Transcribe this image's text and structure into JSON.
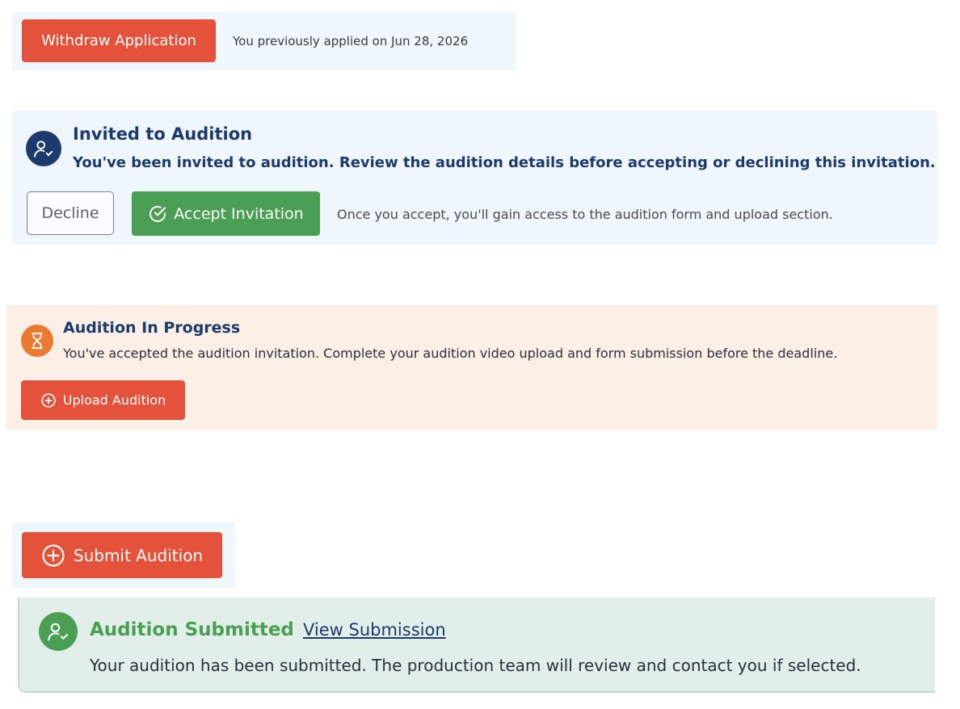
{
  "withdraw": {
    "button_label": "Withdraw Application",
    "applied_text": "You previously applied on Jun 28, 2026"
  },
  "invited": {
    "icon": "user-check-icon",
    "title": "Invited to Audition",
    "description": "You've been invited to audition. Review the audition details before accepting or declining this invitation.",
    "decline_label": "Decline",
    "accept_label": "Accept Invitation",
    "note": "Once you accept, you'll gain access to the audition form and upload section."
  },
  "in_progress": {
    "icon": "hourglass-icon",
    "title": "Audition In Progress",
    "description": "You've accepted the audition invitation. Complete your audition video upload and form submission before the deadline.",
    "upload_label": "Upload Audition"
  },
  "submit": {
    "button_label": "Submit Audition"
  },
  "submitted": {
    "icon": "user-check-icon",
    "title": "Audition Submitted",
    "link_label": "View Submission",
    "description": "Your audition has been submitted. The production team will review and contact you if selected."
  },
  "colors": {
    "brand_red": "#e4523b",
    "navy": "#1c3a6b",
    "green": "#4a9f54",
    "orange": "#ea7a2f",
    "panel_blue": "#f0f6fd",
    "panel_peach": "#fbefe6",
    "panel_mint": "#e1eeea"
  }
}
